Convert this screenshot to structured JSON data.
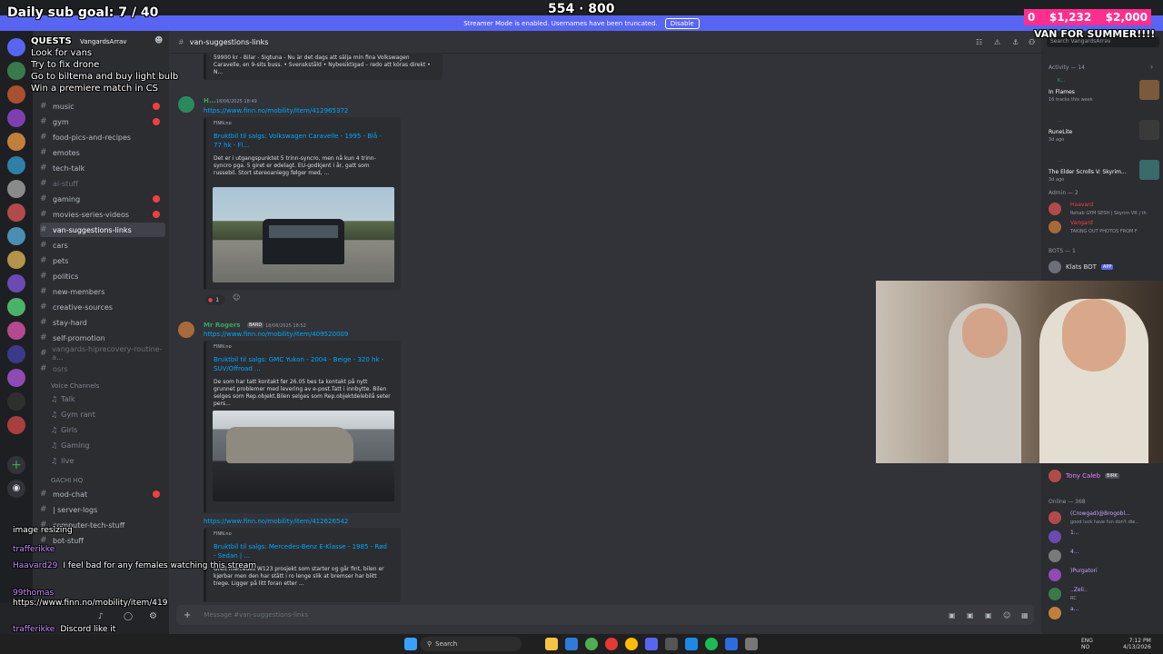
{
  "overlay": {
    "daily_goal": "Daily sub goal: 7 / 40",
    "counter": "554 · 800",
    "money_left": "0",
    "money_mid": "$1,232",
    "money_right": "$2,000",
    "van_fund": "VAN FOR SUMMER!!!!",
    "quests_title": "QUESTS",
    "quests": [
      "Look for vans",
      "Try to fix drone",
      "Go to biltema and buy light bulb",
      "Win a premiere match in CS"
    ],
    "chat_lines": [
      {
        "user": "",
        "text": "image resizing"
      },
      {
        "user": "trafferikke",
        "text": ""
      },
      {
        "user": "Haavard29",
        "text": "I feel bad for any females watching this stream"
      },
      {
        "user": "99thomas",
        "text": ""
      },
      {
        "user": "",
        "text": "https://www.finn.no/mobility/item/419"
      },
      {
        "user": "trafferikke",
        "text": "Discord like it"
      }
    ]
  },
  "banner": {
    "text": "Streamer Mode is enabled. Usernames have been truncated.",
    "button": "Disable"
  },
  "server": {
    "name": "VangardsArrav",
    "channels": [
      {
        "name": "music",
        "badge": true
      },
      {
        "name": "gym",
        "badge": true
      },
      {
        "name": "food-pics-and-recipes",
        "badge": false
      },
      {
        "name": "emotes",
        "badge": false
      },
      {
        "name": "tech-talk",
        "badge": false
      },
      {
        "name": "ai-stuff",
        "badge": false,
        "dim": true
      },
      {
        "name": "gaming",
        "badge": true
      },
      {
        "name": "movies-series-videos",
        "badge": true
      },
      {
        "name": "van-suggestions-links",
        "badge": false,
        "active": true
      },
      {
        "name": "cars",
        "badge": false
      },
      {
        "name": "pets",
        "badge": false
      },
      {
        "name": "politics",
        "badge": false
      },
      {
        "name": "new-members",
        "badge": false
      },
      {
        "name": "creative-sources",
        "badge": false
      },
      {
        "name": "stay-hard",
        "badge": false
      },
      {
        "name": "self-promotion",
        "badge": false
      },
      {
        "name": "vangards-hiprecovery-routine-a...",
        "badge": false,
        "dim": true
      },
      {
        "name": "osrs",
        "badge": false,
        "dim": true
      }
    ],
    "voice_header": "Voice Channels",
    "voice": [
      "Talk",
      "Gym rant",
      "Girls",
      "Gaming",
      "live"
    ],
    "hq_header": "GACHI HQ",
    "hq_channels": [
      {
        "name": "mod-chat",
        "badge": true
      },
      {
        "name": "| server-logs",
        "badge": false
      },
      {
        "name": "computer-tech-stuff",
        "badge": false
      },
      {
        "name": "bot-stuff",
        "badge": false
      }
    ]
  },
  "chat": {
    "channel": "van-suggestions-links",
    "top_embed_desc": "59900 kr - Bilar - Sigtuna - Nu är det dags att sälja min fina Volkswagen Caravelle, en 9-sits buss. • Svenskståld • Nybesiktigad – redo att köras direkt • N...",
    "msg1": {
      "user": "H...",
      "time": "18/06/2025 18:49",
      "link": "https://www.finn.no/mobility/item/412965372",
      "site": "FINN.no",
      "title": "Bruktbil til salgs: Volkswagen Caravelle - 1995 - Blå - 77 hk - Fl...",
      "desc": "Det er i utgangspunktet 5 trinn-syncro, men nå kun 4 trinn-syncro pga. 5 giret er ødelagt. EU-godkjent i år, gatt som russebil. Stort stereoanlegg følger med, ...",
      "reaction": "1"
    },
    "msg2": {
      "user": "Mr Rogers",
      "tag": "BARD",
      "time": "18/06/2025 18:52",
      "link": "https://www.finn.no/mobility/item/409520009",
      "site": "FINN.no",
      "title": "Bruktbil til salgs: GMC Yukon - 2004 - Beige - 320 hk - SUV/Offroad ...",
      "desc": "De som har tatt kontakt før 26.05 bes ta kontakt på nytt grunnet problemer med levering av e-post.Tatt i innbytte. Bilen selges som Rep.objekt.Bilen selges som Rep.objektdelebilå seter pers..."
    },
    "msg3": {
      "link": "https://www.finn.no/mobility/item/412626542",
      "site": "FINN.no",
      "title": "Bruktbil til salgs: Mercedes-Benz E-Klasse - 1985 - Rød - Sedan | ...",
      "desc": "Greit mercedes W123 prosjekt som starter og går fint, bilen er kjørbar men den har stått i ro lenge slik at bremser har blitt trege. Ligger på litt foran etter ..."
    },
    "input_placeholder": "Message #van-suggestions-links"
  },
  "members": {
    "search": "Search VangardsArrav",
    "activity_header": "Activity — 14",
    "activity": [
      {
        "name": "K...",
        "game": "In Flames",
        "sub": "16 tracks this week"
      },
      {
        "name": "...",
        "game": "RuneLite",
        "sub": "3d ago"
      },
      {
        "name": "...",
        "game": "The Elder Scrolls V: Skyrim...",
        "sub": "3d ago"
      }
    ],
    "admin_header": "Admin — 2",
    "admins": [
      {
        "name": "Haavard",
        "status": "Rehab GYM SESH | Skyrim VR | th"
      },
      {
        "name": "Vangard",
        "status": "TAKING OUT PHOTOS FROM F"
      }
    ],
    "bots_header": "BOTS — 1",
    "bot": {
      "name": "Klats BOT",
      "tag": "APP"
    },
    "after_cam": [
      {
        "name": "Tony Caleb",
        "tag": "BIRK"
      }
    ],
    "online_header": "Online — 368",
    "online": [
      {
        "name": "(Crowgad)@Brogobl...",
        "status": "good luck have fun don't die..."
      },
      {
        "name": "1...",
        "status": ""
      },
      {
        "name": "4...",
        "status": ""
      },
      {
        "name": ")Purgatori",
        "status": ""
      },
      {
        "name": "..Zeli..",
        "status": "RC"
      },
      {
        "name": "a...",
        "status": ""
      }
    ]
  },
  "taskbar": {
    "search": "Search",
    "lang": "ENG",
    "region": "NO",
    "time": "7:12 PM",
    "date": "4/13/2026"
  },
  "colors": {
    "accent": "#5865f2",
    "link": "#00a8fc",
    "pink": "#ff2e8f",
    "badge": "#f23f43"
  }
}
